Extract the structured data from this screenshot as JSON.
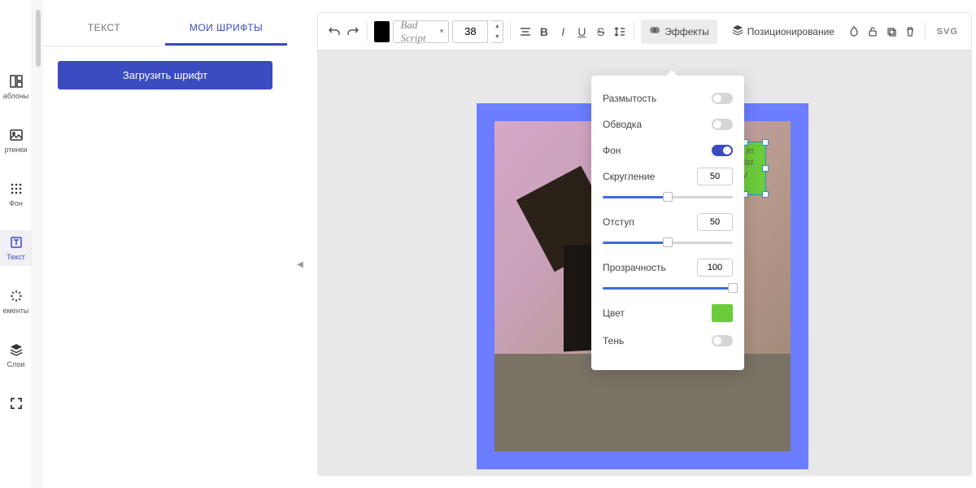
{
  "sidebar": {
    "items": [
      {
        "label": "аблоны",
        "icon": "templates"
      },
      {
        "label": "ртинки",
        "icon": "image"
      },
      {
        "label": "Фон",
        "icon": "grid"
      },
      {
        "label": "Текст",
        "icon": "text",
        "active": true
      },
      {
        "label": "ементы",
        "icon": "elements"
      },
      {
        "label": "Слои",
        "icon": "layers"
      },
      {
        "label": "",
        "icon": "fullscreen"
      }
    ]
  },
  "panel": {
    "tabs": [
      {
        "label": "ТЕКСТ"
      },
      {
        "label": "МОИ ШРИФТЫ",
        "active": true
      }
    ],
    "upload_label": "Загрузить шрифт"
  },
  "toolbar": {
    "font": "Bad Script",
    "size": "38",
    "effects_label": "Эффекты",
    "positioning_label": "Позиционирование",
    "svg_label": "SVG",
    "color": "#000000"
  },
  "effects": {
    "blur": {
      "label": "Размытость",
      "on": false
    },
    "stroke": {
      "label": "Обводка",
      "on": false
    },
    "bg": {
      "label": "Фон",
      "on": true
    },
    "radius": {
      "label": "Скругление",
      "value": "50",
      "pct": 50
    },
    "padding": {
      "label": "Отступ",
      "value": "50",
      "pct": 50
    },
    "opacity": {
      "label": "Прозрачность",
      "value": "100",
      "pct": 100
    },
    "color": {
      "label": "Цвет",
      "value": "#6bcb3a"
    },
    "shadow": {
      "label": "Тень",
      "on": false
    }
  },
  "canvas": {
    "text_content": "ty In\nmist\ny"
  }
}
